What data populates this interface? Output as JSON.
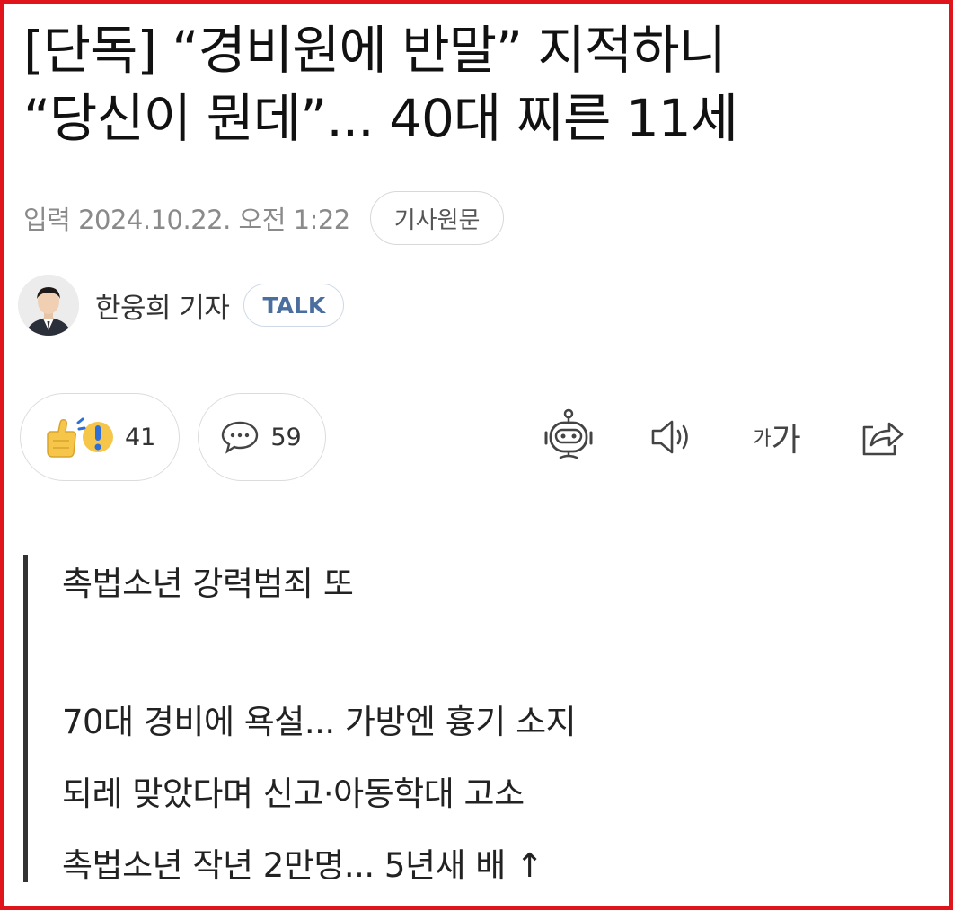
{
  "article": {
    "title_line1": "[단독] “경비원에 반말” 지적하니",
    "title_line2": "“당신이 뭔데”... 40대 찌른 11세",
    "date": "입력 2024.10.22. 오전 1:22",
    "original_label": "기사원문"
  },
  "author": {
    "name": "한웅희 기자",
    "talk_label": "TALK"
  },
  "reactions": {
    "reaction_count": "41",
    "comment_count": "59"
  },
  "toolbar": {
    "font_small": "가",
    "font_big": "가",
    "icons": [
      "robot-icon",
      "speaker-icon",
      "font-size-icon",
      "share-icon"
    ]
  },
  "summary": {
    "lines": [
      "촉법소년 강력범죄 또",
      "70대 경비에 욕설... 가방엔 흉기 소지",
      "되레 맞았다며 신고·아동학대 고소",
      "촉법소년 작년 2만명... 5년새 배 ↑"
    ]
  },
  "colors": {
    "frame": "#e0141b",
    "talk": "#4a6e9e",
    "meta": "#8a8a8a"
  }
}
